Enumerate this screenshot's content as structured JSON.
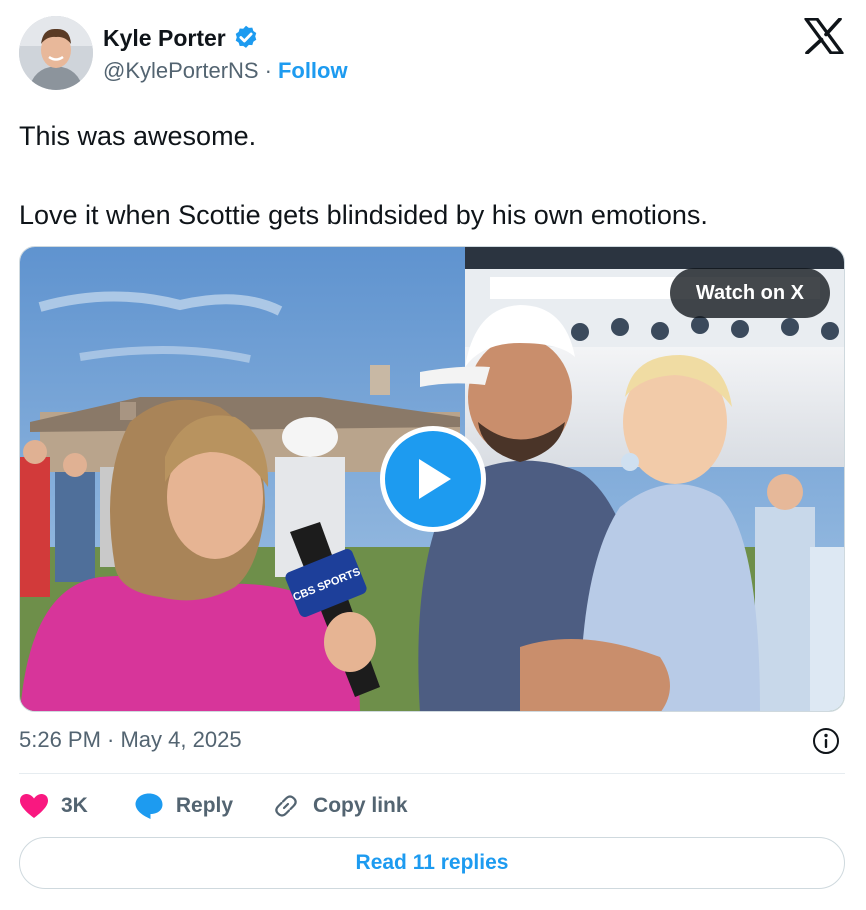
{
  "author": {
    "name": "Kyle Porter",
    "handle": "@KylePorterNS",
    "separator": "·",
    "follow_label": "Follow",
    "verified_color": "#1d9bf0"
  },
  "tweet": {
    "lines": [
      "This was awesome.",
      "Love it when Scottie gets blindsided by his own emotions."
    ]
  },
  "media": {
    "watch_label": "Watch on X",
    "play_icon": "play-icon",
    "mic_flag_text": "CBS SPORTS"
  },
  "meta": {
    "timestamp": "5:26 PM · May 4, 2025",
    "info_icon": "info-icon"
  },
  "actions": {
    "like_count": "3K",
    "reply_label": "Reply",
    "copy_link_label": "Copy link",
    "like_color": "#f91880",
    "reply_color": "#1d9bf0"
  },
  "footer": {
    "read_replies_label": "Read 11 replies"
  },
  "colors": {
    "accent": "#1d9bf0",
    "text_primary": "#0f1419",
    "text_secondary": "#536471"
  }
}
